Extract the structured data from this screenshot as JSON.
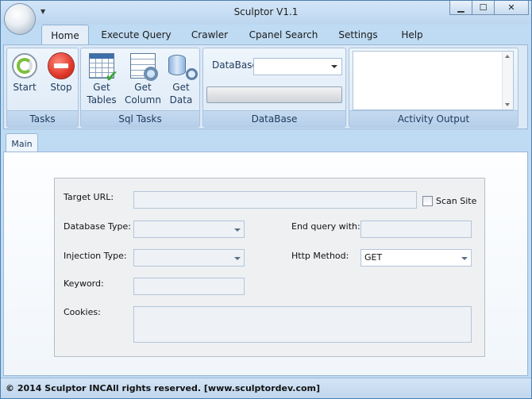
{
  "window": {
    "title": "Sculptor V1.1"
  },
  "ribbon_tabs": [
    "Home",
    "Execute Query",
    "Crawler",
    "Cpanel Search",
    "Settings",
    "Help"
  ],
  "active_tab": "Home",
  "groups": {
    "tasks": {
      "label": "Tasks",
      "start_label": "Start",
      "stop_label": "Stop"
    },
    "sql_tasks": {
      "label": "Sql Tasks",
      "get_tables": [
        "Get",
        "Tables"
      ],
      "get_column": [
        "Get",
        "Column"
      ],
      "get_data": [
        "Get",
        "Data"
      ]
    },
    "database": {
      "label": "DataBase",
      "combo_label": "DataBase",
      "combo_value": ""
    },
    "activity": {
      "label": "Activity Output",
      "text": ""
    }
  },
  "document_tabs": [
    "Main"
  ],
  "form": {
    "target_url_label": "Target URL:",
    "target_url_value": "",
    "scan_site_label": "Scan Site",
    "scan_site_checked": false,
    "database_type_label": "Database Type:",
    "database_type_value": "",
    "end_query_label": "End query with:",
    "end_query_value": "",
    "injection_type_label": "Injection Type:",
    "injection_type_value": "",
    "http_method_label": "Http Method:",
    "http_method_value": "GET",
    "keyword_label": "Keyword:",
    "keyword_value": "",
    "cookies_label": "Cookies:",
    "cookies_value": ""
  },
  "status": {
    "text": "© 2014 Sculptor INCAll rights reserved.  [www.sculptordev.com]"
  }
}
